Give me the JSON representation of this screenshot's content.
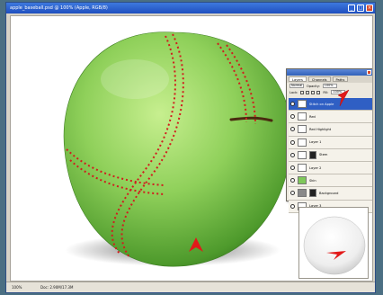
{
  "window": {
    "title": "apple_baseball.psd @ 100% (Apple, RGB/8)"
  },
  "status": {
    "zoom": "100%",
    "doc": "Doc: 2.90M/17.3M"
  },
  "layers_panel": {
    "tabs": [
      "Layers",
      "Channels",
      "Paths"
    ],
    "blend_mode": "Normal",
    "opacity_label": "Opacity:",
    "opacity_value": "100%",
    "lock_label": "Lock:",
    "fill_label": "Fill:",
    "fill_value": "100%",
    "layers": [
      {
        "name": "Stitch on Apple",
        "selected": true
      },
      {
        "name": "Red",
        "selected": false
      },
      {
        "name": "Red Highlight",
        "selected": false
      },
      {
        "name": "Layer 1",
        "selected": false
      },
      {
        "name": "Stem",
        "selected": false
      },
      {
        "name": "Layer 2",
        "selected": false
      },
      {
        "name": "Skin",
        "selected": false
      },
      {
        "name": "Background",
        "selected": false
      },
      {
        "name": "Layer 3",
        "selected": false
      }
    ]
  },
  "colors": {
    "apple_green": "#8fd05a",
    "stitch_red": "#d11d1d",
    "selection_blue": "#2f5fc4",
    "pointer_red": "#e21919"
  }
}
